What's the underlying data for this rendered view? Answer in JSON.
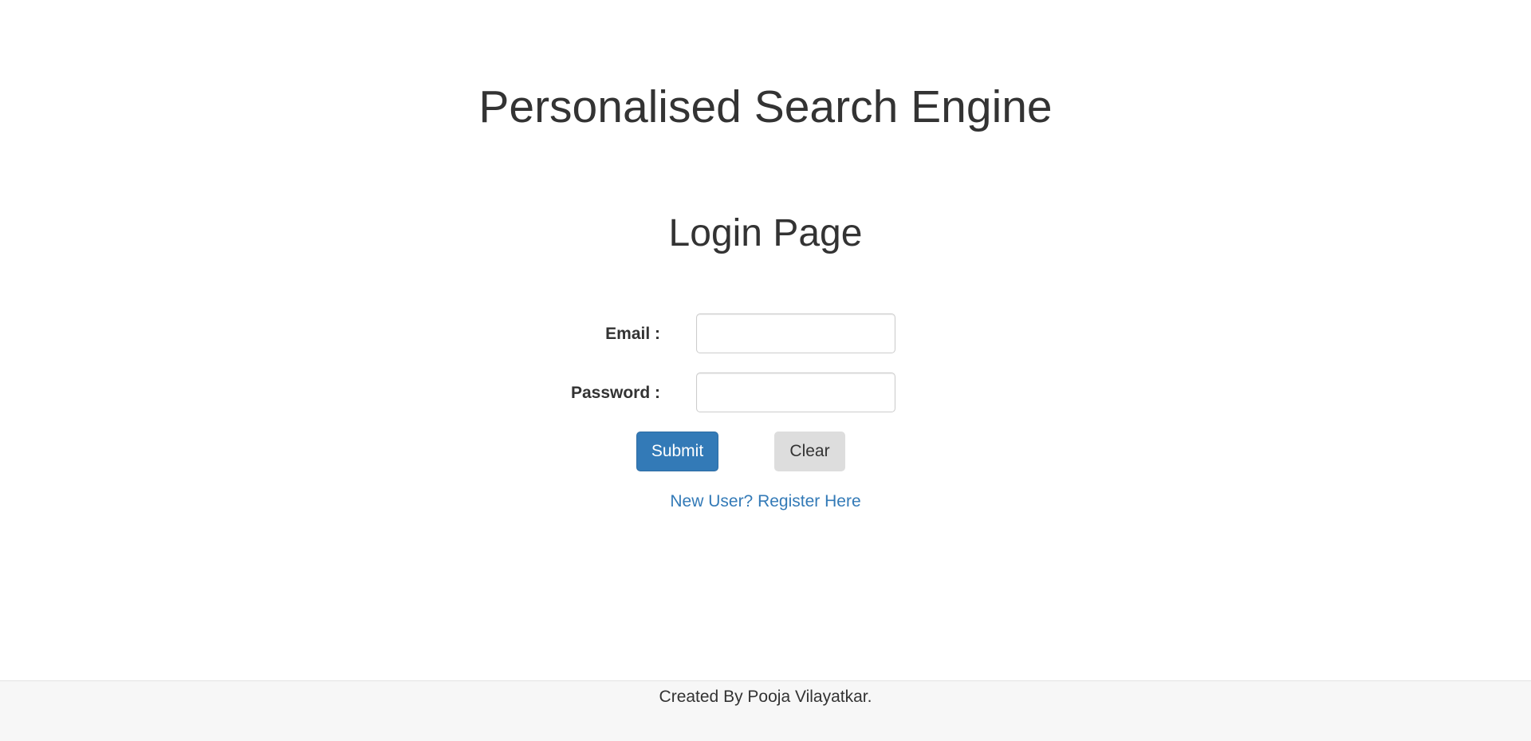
{
  "header": {
    "site_title": "Personalised Search Engine"
  },
  "main": {
    "heading": "Login Page",
    "form": {
      "email_label": "Email :",
      "email_value": "",
      "password_label": "Password :",
      "password_value": "",
      "submit_label": "Submit",
      "clear_label": "Clear"
    },
    "register_link": "New User? Register Here"
  },
  "footer": {
    "credit": "Created By Pooja Vilayatkar."
  },
  "colors": {
    "primary": "#337ab7",
    "text": "#333333",
    "footer_bg": "#f7f7f7",
    "clear_button_bg": "#dddddd"
  }
}
